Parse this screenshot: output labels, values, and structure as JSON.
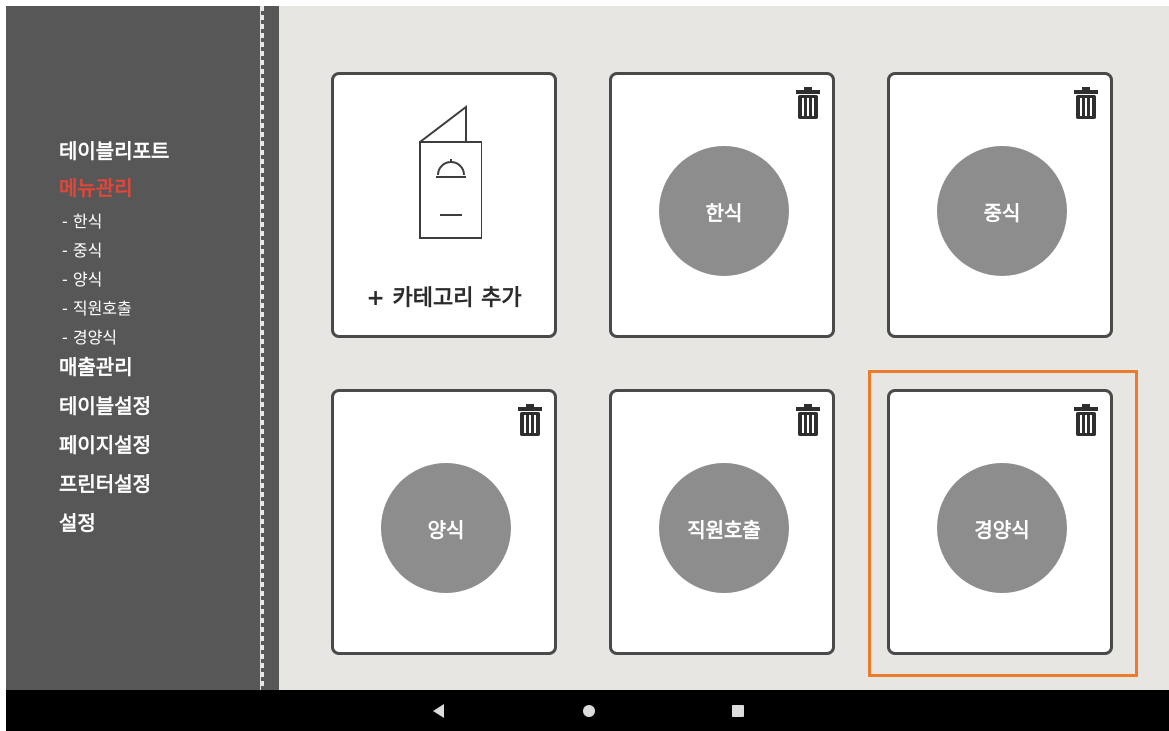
{
  "sidebar": {
    "items": [
      {
        "label": "테이블리포트",
        "active": false
      },
      {
        "label": "메뉴관리",
        "active": true,
        "sub": [
          "- 한식",
          "- 중식",
          "- 양식",
          "- 직원호출",
          "- 경양식"
        ]
      },
      {
        "label": "매출관리",
        "active": false
      },
      {
        "label": "테이블설정",
        "active": false
      },
      {
        "label": "페이지설정",
        "active": false
      },
      {
        "label": "프린터설정",
        "active": false
      },
      {
        "label": "설정",
        "active": false
      }
    ],
    "active_color": "#e0473a"
  },
  "categories": {
    "add_label": "+ 카테고리 추가",
    "cards": [
      "한식",
      "중식",
      "양식",
      "직원호출",
      "경양식"
    ],
    "selected": "경양식",
    "highlight_color": "#ec7b2b"
  },
  "icons": {
    "delete": "trash-icon",
    "add": "menu-booklet-icon",
    "nav": [
      "back-triangle-icon",
      "home-circle-icon",
      "recents-square-icon"
    ]
  }
}
